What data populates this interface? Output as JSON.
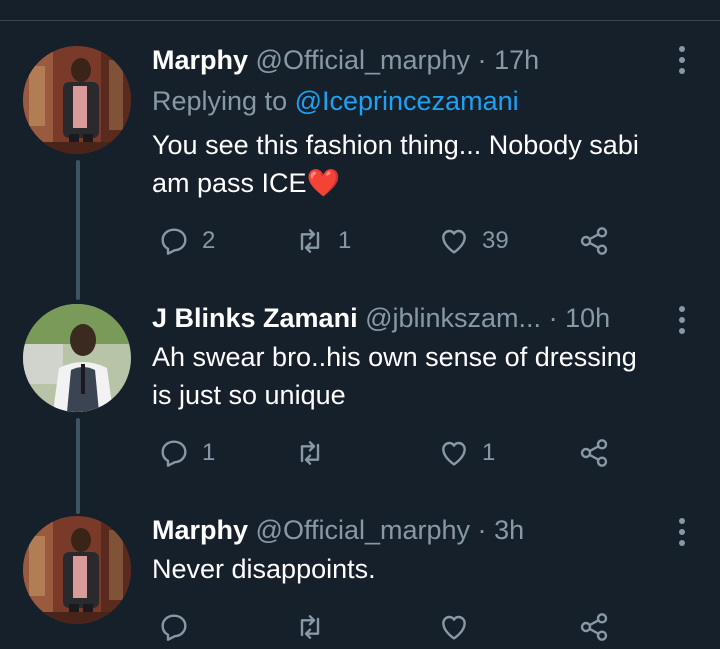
{
  "tweets": [
    {
      "name": "Marphy",
      "handle": "@Official_marphy",
      "dot": "·",
      "time": "17h",
      "replying_prefix": "Replying to ",
      "replying_mention": "@Iceprincezamani",
      "text_line1": "You see this fashion thing... Nobody sabi",
      "text_line2": "am pass ICE",
      "emoji": "❤️",
      "replies": "2",
      "retweets": "1",
      "likes": "39"
    },
    {
      "name": "J Blinks Zamani",
      "handle": "@jblinkszam...",
      "dot": "·",
      "time": "10h",
      "text_line1": "Ah swear bro..his own sense of dressing",
      "text_line2": "is just so unique",
      "replies": "1",
      "retweets": "",
      "likes": "1"
    },
    {
      "name": "Marphy",
      "handle": "@Official_marphy",
      "dot": "·",
      "time": "3h",
      "text_line1": "Never disappoints.",
      "replies": "",
      "retweets": "",
      "likes": ""
    }
  ],
  "icons": {
    "reply": "reply-icon",
    "retweet": "retweet-icon",
    "like": "heart-icon",
    "share": "share-icon",
    "more": "more-vertical-icon"
  },
  "colors": {
    "background": "#15202b",
    "secondary_text": "#8899a6",
    "link": "#1da1f2",
    "thread_line": "#3d5466"
  }
}
